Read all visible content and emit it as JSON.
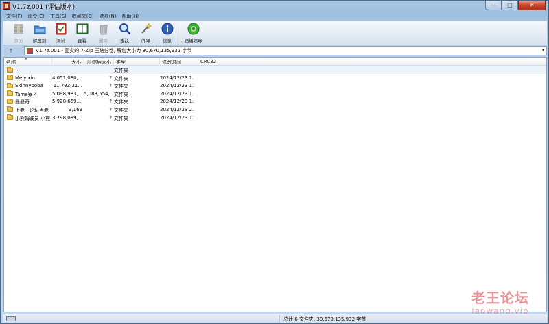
{
  "window": {
    "title": "V1.7z.001 (评估版本)",
    "controls": {
      "minimize": "—",
      "maximize": "□",
      "close": "✕"
    }
  },
  "menu": [
    "文件(F)",
    "命令(C)",
    "工具(S)",
    "收藏夹(O)",
    "选项(N)",
    "帮助(H)"
  ],
  "toolbar": {
    "buttons": [
      {
        "label": "添加",
        "icon": "add-archive-icon",
        "enabled": false
      },
      {
        "label": "解压到",
        "icon": "extract-to-icon",
        "enabled": true
      },
      {
        "label": "测试",
        "icon": "test-icon",
        "enabled": true
      },
      {
        "label": "查看",
        "icon": "view-book-icon",
        "enabled": true
      },
      {
        "label": "删除",
        "icon": "delete-trash-icon",
        "enabled": false
      },
      {
        "label": "查找",
        "icon": "find-magnifier-icon",
        "enabled": true
      },
      {
        "label": "向导",
        "icon": "wizard-wand-icon",
        "enabled": true
      },
      {
        "label": "信息",
        "icon": "info-icon",
        "enabled": true
      },
      {
        "label": "扫描病毒",
        "icon": "virus-scan-icon",
        "enabled": true
      }
    ]
  },
  "address": {
    "up_label": "↑",
    "text": "V1.7z.001 - 固实的 7-Zip 压缩分卷, 解包大小为 30,670,135,932 字节",
    "dropdown": "▾"
  },
  "columns": [
    "名称",
    "大小",
    "压缩后大小",
    "类型",
    "修改时间",
    "CRC32"
  ],
  "files": [
    {
      "name": "..",
      "size": "",
      "packed": "",
      "type": "文件夹",
      "modified": "",
      "crc": ""
    },
    {
      "name": "Meiyixin",
      "size": "4,051,080,...",
      "packed": "?",
      "type": "文件夹",
      "modified": "2024/12/23 1...",
      "crc": ""
    },
    {
      "name": "Skinnyboba",
      "size": "11,793,31...",
      "packed": "?",
      "type": "文件夹",
      "modified": "2024/12/23 1...",
      "crc": ""
    },
    {
      "name": "Tame寮 4",
      "size": "5,098,983,...",
      "packed": "5,083,554,...",
      "type": "文件夹",
      "modified": "2024/12/23 1...",
      "crc": ""
    },
    {
      "name": "曼曼奇",
      "size": "5,928,659,...",
      "packed": "?",
      "type": "文件夹",
      "modified": "2024/12/23 1...",
      "crc": ""
    },
    {
      "name": "上老王论坛当老王",
      "size": "3,169",
      "packed": "?",
      "type": "文件夹",
      "modified": "2024/12/23 2...",
      "crc": ""
    },
    {
      "name": "小熊姆驶员 小熊",
      "size": "3,798,089,...",
      "packed": "?",
      "type": "文件夹",
      "modified": "2024/12/23 1...",
      "crc": ""
    }
  ],
  "status": {
    "summary": "总计 6 文件夹, 30,670,135,932 字节"
  },
  "watermark": {
    "chinese": "老王论坛",
    "url": "laowang.vip"
  }
}
